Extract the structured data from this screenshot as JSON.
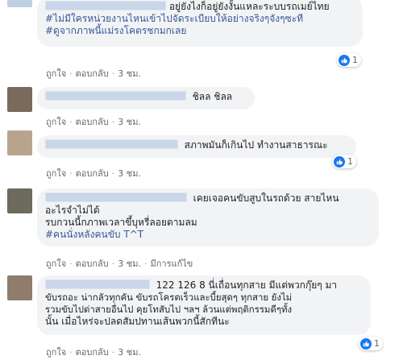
{
  "actions": {
    "like": "ถูกใจ",
    "reply": "ตอบกลับ",
    "time": "3 ชม.",
    "edited": "มีการแก้ไข"
  },
  "like_icon": "thumbs-up-icon",
  "colors": {
    "link": "#385898",
    "like_badge": "#1877f2",
    "bubble": "#f2f3f5"
  },
  "comments": [
    {
      "lines": [
        "อยู่ยังไงก็อยู่ยังงั้นแหละระบบรถเมย์ไทย",
        "#ไม่มีใครหน่วยงานไหนเข้าไปจัดระเบียบให้อย่างจริงๆจังๆซะที",
        "#ดูจากภาพนี้แม่รงโคตรชกมกเลย"
      ],
      "reactions": "1"
    },
    {
      "lines": [
        "ชิลล ชิลล"
      ]
    },
    {
      "lines": [
        "สภาพมันก็เกินไป ทำงานสาธารณะ"
      ],
      "reactions": "1"
    },
    {
      "lines": [
        "เคยเจอคนขับสูบในรถด้วย สายไหน",
        "อะไรจำไม่ได้",
        "รบกวนนี้กภาพเวลาขึ้บุหรี่ลอยตามลม",
        "#คนนั่งหลังคนขับ T^T"
      ]
    },
    {
      "lines": [
        "122 126 8 นี่เถื่อนทุกสาย มีแต่พวกกุ๊ยๆ มา",
        "ขับรถอะ น่ากลัวทุกคัน ขับรถโครตเร็วและบี้ยสุดๆ ทุกสาย ยังไม่",
        "รวมขับไปด่าสายอื่นไป คุยโทสับไป ฯลฯ ล้วนแต่พฤติกรรมดีๆทั้ง",
        "นั้น เมื่อไหร่จะปลดสัมปทานเส้นพวกนี้สักทีนะ"
      ],
      "reactions": "1"
    }
  ]
}
